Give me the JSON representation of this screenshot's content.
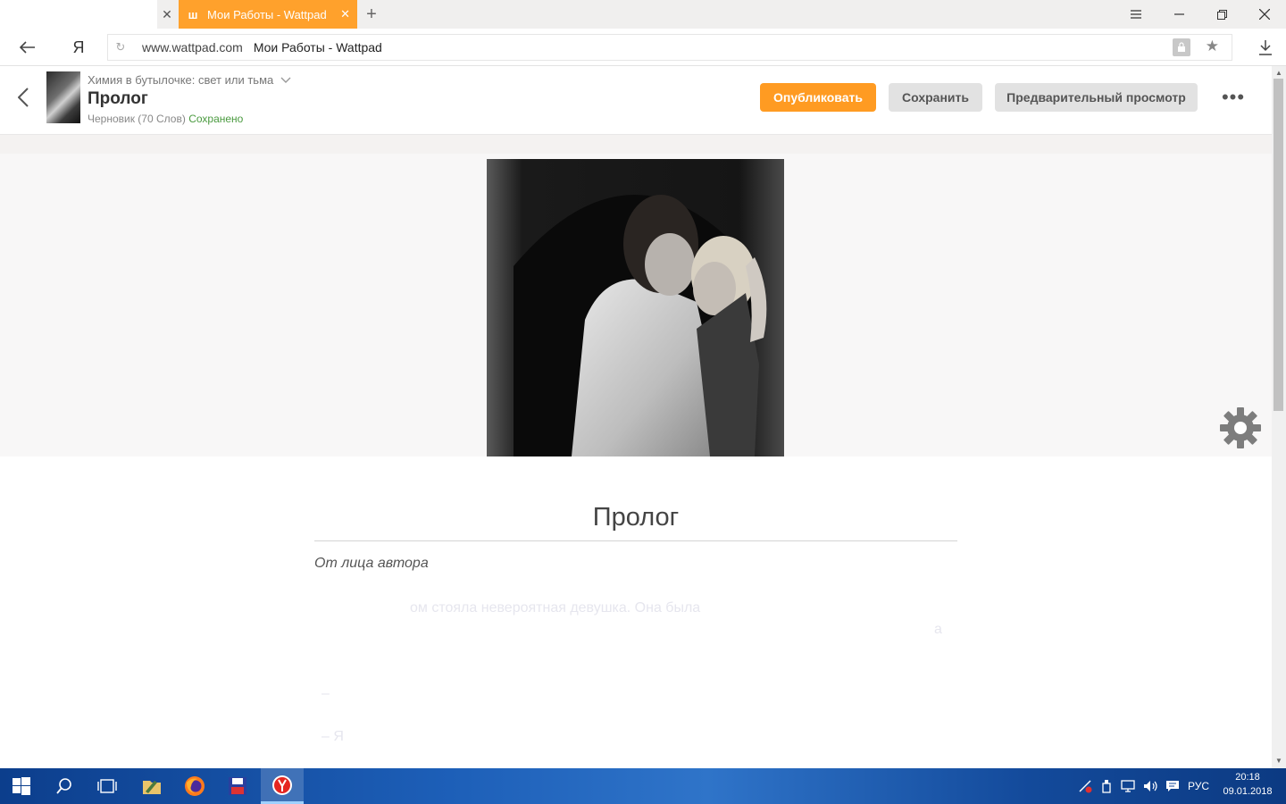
{
  "browser": {
    "tab_title": "Мои Работы - Wattpad",
    "tab_favicon": "ш",
    "tab_close": "✕",
    "new_tab": "+",
    "url_domain": "www.wattpad.com",
    "url_page_title": "Мои Работы - Wattpad",
    "yandex_button": "Я"
  },
  "header": {
    "story_title": "Химия в бутылочке: свет или тьма",
    "part_title": "Пролог",
    "status": "Черновик (70 Слов)",
    "saved": "Сохранено",
    "publish_label": "Опубликовать",
    "save_label": "Сохранить",
    "preview_label": "Предварительный просмотр",
    "more_label": "•••"
  },
  "editor": {
    "chapter_heading": "Пролог",
    "pov_line": "От лица автора",
    "faded_lines": [
      "ом стояла невероятная девушка. Она была",
      "а",
      "–",
      "–  Я"
    ]
  },
  "taskbar": {
    "language": "РУС",
    "time": "20:18",
    "date": "09.01.2018"
  },
  "colors": {
    "accent": "#ff9b22",
    "tab_active": "#ffa12c",
    "saved_green": "#4a9a3f",
    "button_gray": "#e2e2e2"
  }
}
